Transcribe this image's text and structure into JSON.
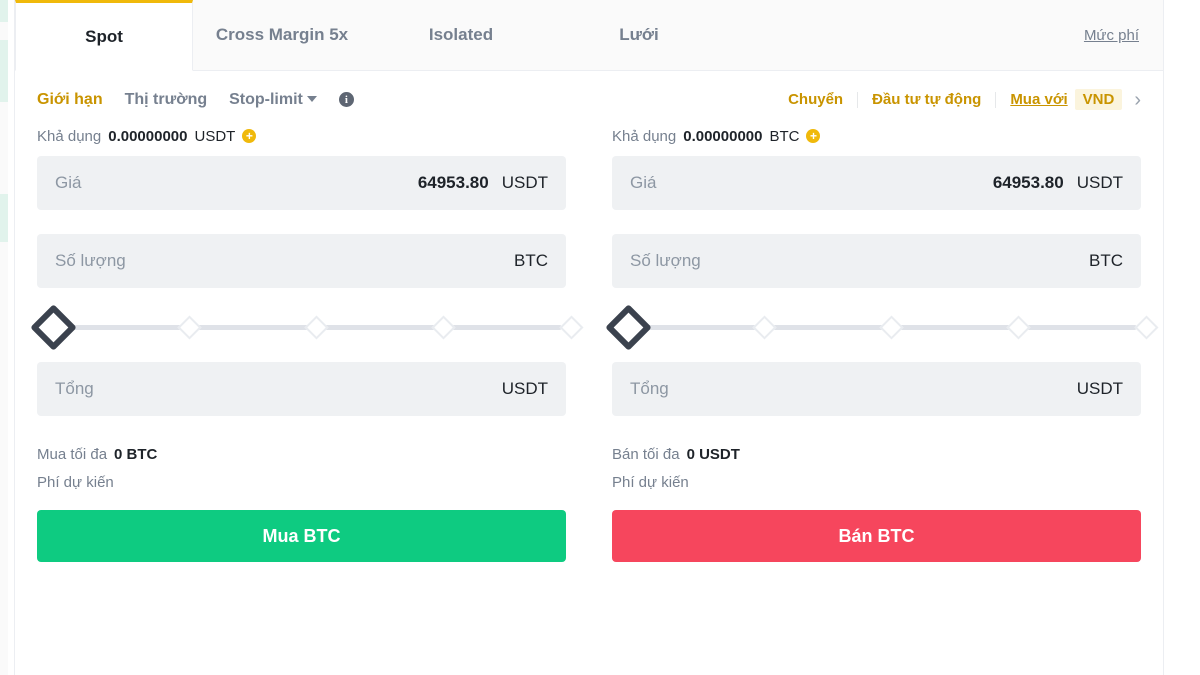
{
  "tabs": [
    {
      "label": "Spot",
      "active": true
    },
    {
      "label": "Cross Margin 5x",
      "active": false
    },
    {
      "label": "Isolated",
      "active": false
    },
    {
      "label": "Lưới",
      "active": false
    }
  ],
  "fee_link": "Mức phí",
  "order_types": [
    {
      "label": "Giới hạn",
      "active": true
    },
    {
      "label": "Thị trường",
      "active": false
    },
    {
      "label": "Stop-limit",
      "active": false,
      "has_caret": true
    }
  ],
  "info_icon_glyph": "i",
  "toolbar_right": {
    "transfer_label": "Chuyển",
    "auto_invest_label": "Đầu tư tự động",
    "buy_with_label": "Mua với",
    "currency_badge": "VND",
    "chevron_glyph": "›"
  },
  "buy": {
    "available_label": "Khả dụng",
    "available_amount": "0.00000000",
    "available_unit": "USDT",
    "add_funds_glyph": "+",
    "price_label": "Giá",
    "price_value": "64953.80",
    "price_unit": "USDT",
    "amount_label": "Số lượng",
    "amount_value": "",
    "amount_unit": "BTC",
    "total_label": "Tổng",
    "total_value": "",
    "total_unit": "USDT",
    "max_label": "Mua tối đa",
    "max_value": "0 BTC",
    "fee_label": "Phí dự kiến",
    "fee_value": "",
    "action_label": "Mua BTC",
    "slider_percent": 0
  },
  "sell": {
    "available_label": "Khả dụng",
    "available_amount": "0.00000000",
    "available_unit": "BTC",
    "add_funds_glyph": "+",
    "price_label": "Giá",
    "price_value": "64953.80",
    "price_unit": "USDT",
    "amount_label": "Số lượng",
    "amount_value": "",
    "amount_unit": "BTC",
    "total_label": "Tổng",
    "total_value": "",
    "total_unit": "USDT",
    "max_label": "Bán tối đa",
    "max_value": "0 USDT",
    "fee_label": "Phí dự kiến",
    "fee_value": "",
    "action_label": "Bán BTC",
    "slider_percent": 0
  },
  "colors": {
    "accent": "#f0b90b",
    "accent_text": "#c99400",
    "buy_green": "#0ecb81",
    "sell_red": "#f6465d",
    "field_bg": "#eff1f3",
    "muted_text": "#76808f",
    "primary_text": "#1e2329",
    "edge_mint": "#e1f3ec"
  }
}
